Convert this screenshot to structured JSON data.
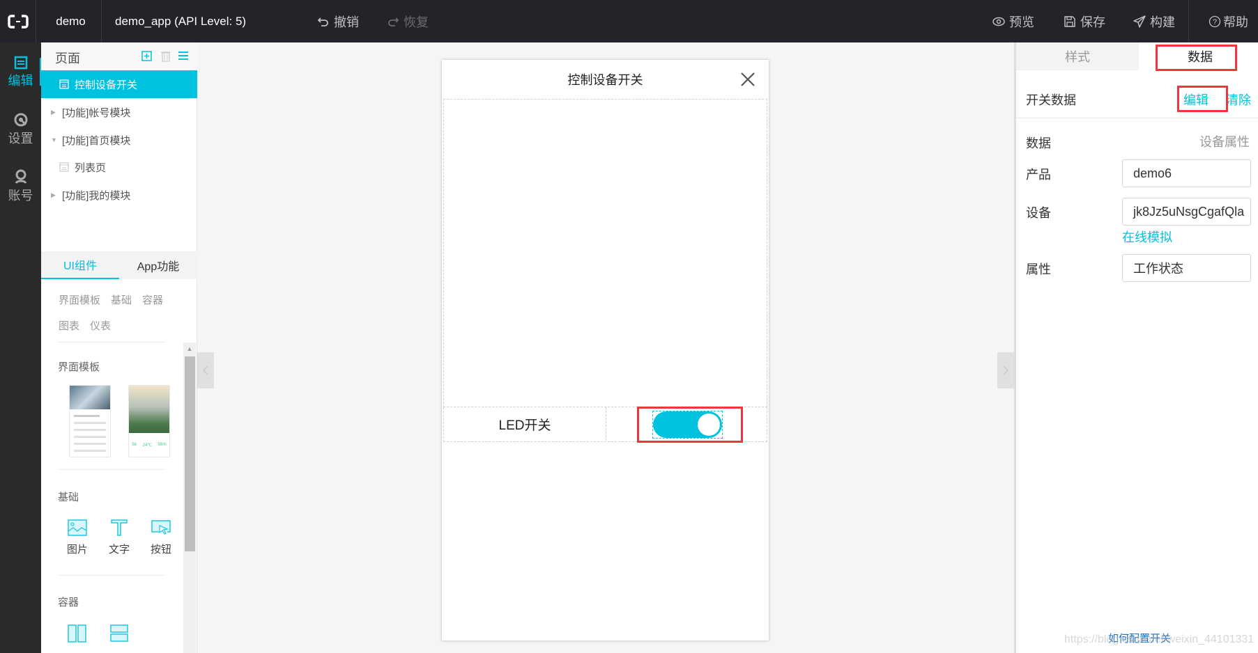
{
  "topbar": {
    "app_name": "demo",
    "project": "demo_app (API Level: 5)",
    "undo": "撤销",
    "redo": "恢复",
    "preview": "预览",
    "save": "保存",
    "build": "构建",
    "help": "帮助"
  },
  "leftnav": {
    "items": [
      {
        "label": "编辑",
        "icon": "edit-icon",
        "active": true
      },
      {
        "label": "设置",
        "icon": "settings-icon",
        "active": false
      },
      {
        "label": "账号",
        "icon": "account-icon",
        "active": false
      }
    ]
  },
  "pages": {
    "title": "页面",
    "items": [
      {
        "label": "控制设备开关",
        "type": "page",
        "active": true
      },
      {
        "label": "[功能]帐号模块",
        "type": "module",
        "expanded": false
      },
      {
        "label": "[功能]首页模块",
        "type": "module",
        "expanded": true
      },
      {
        "label": "列表页",
        "type": "page",
        "active": false
      },
      {
        "label": "[功能]我的模块",
        "type": "module",
        "expanded": false
      }
    ]
  },
  "components": {
    "tabs": [
      {
        "label": "UI组件",
        "active": true
      },
      {
        "label": "App功能",
        "active": false
      }
    ],
    "categories": [
      "界面模板",
      "基础",
      "容器",
      "图表",
      "仪表"
    ],
    "sections": {
      "templates": "界面模板",
      "basic": "基础",
      "container": "容器"
    },
    "basic_tools": [
      "图片",
      "文字",
      "按钮"
    ],
    "template_preview": {
      "weather_values": [
        "56",
        "24℃",
        "56%"
      ]
    }
  },
  "phone": {
    "title": "控制设备开关",
    "led_label": "LED开关",
    "switch_on": true
  },
  "props": {
    "tabs": [
      {
        "label": "样式",
        "active": false
      },
      {
        "label": "数据",
        "active": true
      }
    ],
    "switch_data_label": "开关数据",
    "edit_link": "编辑",
    "clear_link": "清除",
    "data_label": "数据",
    "data_source": "设备属性",
    "product_label": "产品",
    "product_value": "demo6",
    "device_label": "设备",
    "device_value": "jk8Jz5uNsgCgafQla",
    "simulate_link": "在线模拟",
    "attr_label": "属性",
    "attr_value": "工作状态",
    "help_link": "如何配置开关"
  },
  "watermark": "https://blog.csdn.net/weixin_44101331",
  "colors": {
    "accent": "#00c1de",
    "highlight": "#f0353c",
    "topbar_bg": "#232429"
  }
}
